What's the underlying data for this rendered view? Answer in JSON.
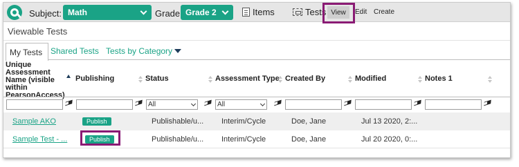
{
  "toolbar": {
    "subject_label": "Subject:",
    "subject_value": "Math",
    "grade_label": "Grade:",
    "grade_value": "Grade 2",
    "items_label": "Items",
    "tests_label": "Tests",
    "view_label": "View",
    "edit_label": "Edit",
    "create_label": "Create"
  },
  "page": {
    "title": "Viewable Tests"
  },
  "tabs": [
    {
      "label": "My Tests",
      "active": true
    },
    {
      "label": "Shared Tests",
      "active": false
    },
    {
      "label": "Tests by Category",
      "active": false
    }
  ],
  "table": {
    "columns": [
      "Unique Assessment Name (visible within PearsonAccess)",
      "Publishing",
      "Status",
      "Assessment Type",
      "Created By",
      "Modified",
      "Notes 1"
    ],
    "filters": {
      "status": "All",
      "assessment_type": "All"
    },
    "rows": [
      {
        "name": "Sample AKO",
        "publishing": "Publish",
        "status": "Publishable/u...",
        "type": "Interim/Cycle",
        "created_by": "Doe, Jane",
        "modified": "Jul 13 2020, 2:...",
        "notes": ""
      },
      {
        "name": "Sample Test - ...",
        "publishing": "Publish",
        "status": "Publishable/u...",
        "type": "Interim/Cycle",
        "created_by": "Doe, Jane",
        "modified": "Jul 20 2020, 0:...",
        "notes": ""
      }
    ]
  },
  "colors": {
    "accent": "#1aa386",
    "highlight": "#8a1a74"
  }
}
